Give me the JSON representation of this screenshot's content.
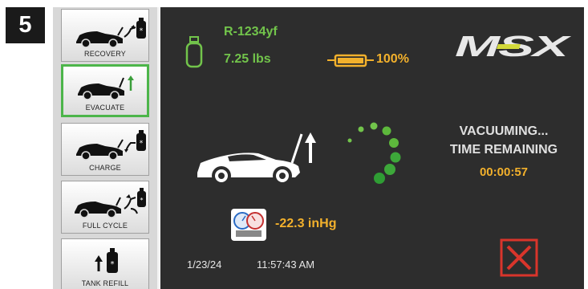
{
  "step_number": "5",
  "sidebar": {
    "items": [
      {
        "label": "RECOVERY",
        "icon": "car-recovery-icon"
      },
      {
        "label": "EVACUATE",
        "icon": "car-evacuate-icon",
        "active": true
      },
      {
        "label": "CHARGE",
        "icon": "car-charge-icon"
      },
      {
        "label": "FULL CYCLE",
        "icon": "car-full-cycle-icon"
      },
      {
        "label": "TANK REFILL",
        "icon": "tank-refill-icon"
      }
    ]
  },
  "status": {
    "refrigerant": "R-1234yf",
    "weight": "7.25 lbs",
    "battery": "100%",
    "battery_level": 1.0
  },
  "brand": {
    "logo_text": "MSX"
  },
  "process": {
    "line1": "VACUUMING...",
    "line2": "TIME REMAINING",
    "time_remaining": "00:00:57"
  },
  "gauge": {
    "pressure": "-22.3 inHg"
  },
  "footer": {
    "date": "1/23/24",
    "time": "11:57:43 AM"
  },
  "colors": {
    "accent_green": "#72c44b",
    "accent_amber": "#f3b12c",
    "cancel_red": "#d9352b",
    "background": "#2d2d2d"
  }
}
